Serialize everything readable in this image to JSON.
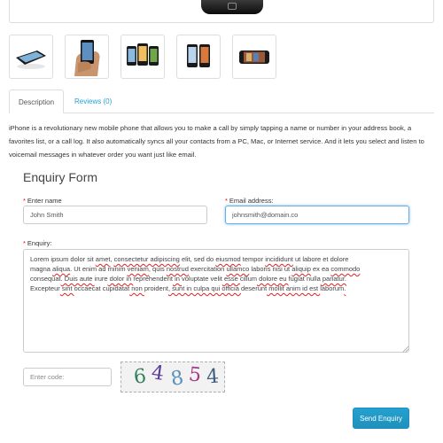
{
  "tabs": [
    {
      "label": "Description"
    },
    {
      "label": "Reviews (0)"
    }
  ],
  "description": "iPhone is a revolutionary new mobile phone that allows you to make a call by simply tapping a name or number in your address book, a favorites list, or a call log. It also automatically syncs all your contacts from a PC, Mac, or Internet service. And it lets you select and listen to voicemail messages in whatever order you want just like email.",
  "form": {
    "title": "Enquiry Form",
    "required_mark": "*",
    "name_label": "Enter name",
    "name_value": "John Smith",
    "email_label": "Email address:",
    "email_value": "johnsmith@domain.co",
    "enquiry_label": "Enquiry:",
    "enquiry_text": [
      [
        "Lorem ipsum dolor sit ",
        "amet",
        ", ",
        "consectetur adipiscing",
        " elit, sed do ",
        "eiusmod",
        " tempor ",
        "incididunt",
        " ut labore et dolore"
      ],
      [
        "magna ",
        "aliqua",
        ". Ut enim ad minim ",
        "veniam",
        ", quis ",
        "nostrud",
        " exercitation ",
        "ullamco",
        " laboris nisi ut ",
        "aliquip",
        " ex ea ",
        "commodo"
      ],
      [
        "consequat",
        ". Duis aute ",
        "irure",
        " dolor in ",
        "reprehenderit",
        " in ",
        "voluptate velit",
        " esse ",
        "cillum",
        " dolore eu ",
        "fugiat nulla",
        " pariatur."
      ],
      [
        "Excepteur",
        " sint ",
        "occaecat cupidatat",
        " non ",
        "proident",
        ", sunt in culpa qui officia ",
        "deserunt",
        " mollit anim id est ",
        "laborum",
        "."
      ]
    ],
    "captcha_placeholder": "Enter code:",
    "captcha_code": "64854",
    "submit_label": "Send Enquiry"
  },
  "colors": {
    "link": "#23a1d1",
    "button": "#229ac8",
    "required": "#f00000"
  },
  "thumbnails": [
    "iphone-lying-flat",
    "iphone-in-hand",
    "three-iphones-front",
    "two-iphones-side",
    "iphone-landscape"
  ]
}
